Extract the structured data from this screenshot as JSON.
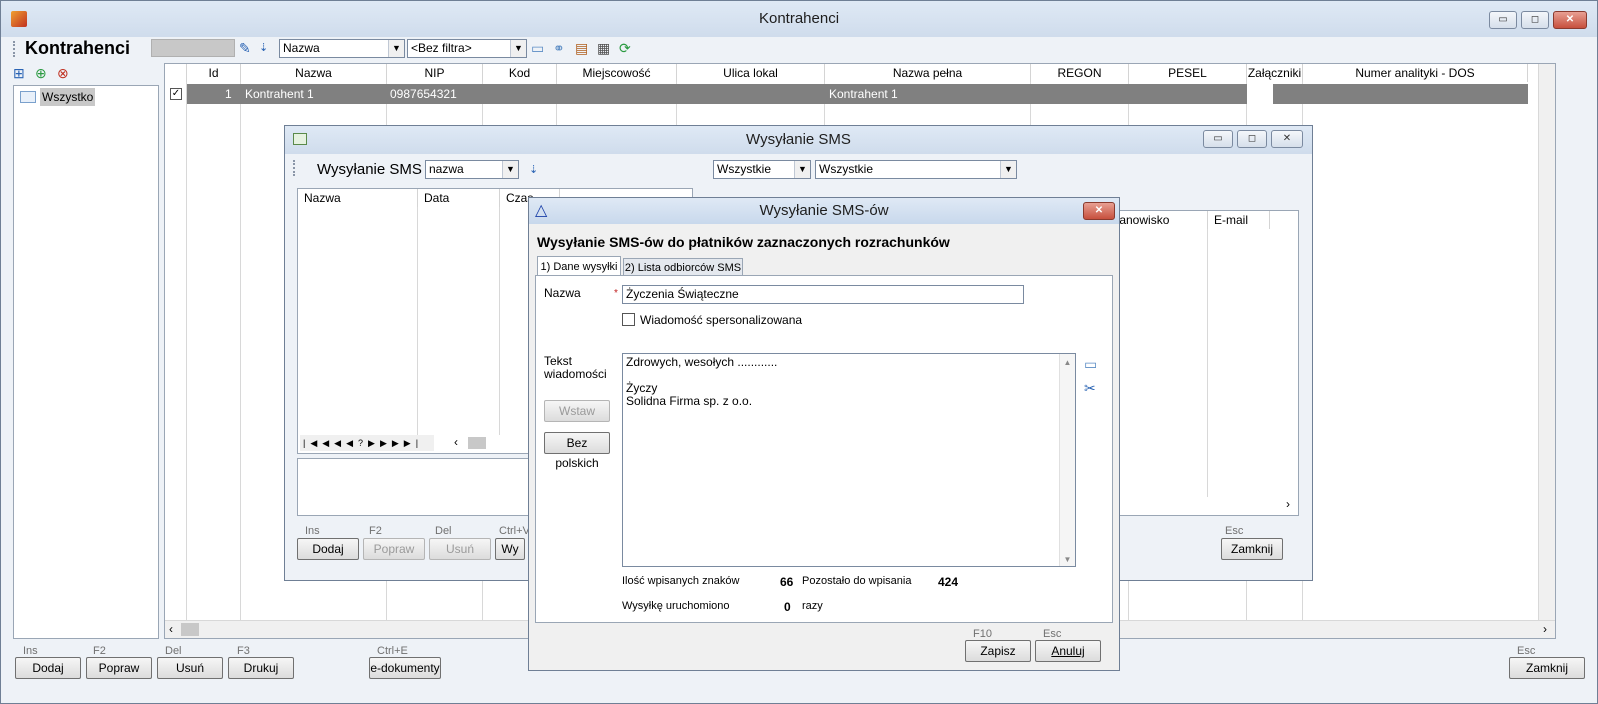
{
  "main": {
    "title": "Kontrahenci",
    "toolbar_title": "Kontrahenci",
    "sort_combo": "Nazwa",
    "filter_combo": "<Bez filtra>",
    "tree_item": "Wszystko",
    "columns": [
      "Id",
      "Nazwa",
      "NIP",
      "Kod pocztowy",
      "Miejscowość",
      "Ulica lokal",
      "Nazwa pełna",
      "REGON",
      "PESEL",
      "Załączniki",
      "Numer analityki - DOS"
    ],
    "row": {
      "id": "1",
      "nazwa": "Kontrahent 1",
      "nip": "0987654321",
      "nazwa_pelna": "Kontrahent 1"
    },
    "buttons": {
      "dodaj": {
        "key": "Ins",
        "label": "Dodaj"
      },
      "popraw": {
        "key": "F2",
        "label": "Popraw"
      },
      "usun": {
        "key": "Del",
        "label": "Usuń"
      },
      "drukuj": {
        "key": "F3",
        "label": "Drukuj"
      },
      "edok": {
        "key": "Ctrl+E",
        "label": "e-dokumenty"
      },
      "zamknij": {
        "key": "Esc",
        "label": "Zamknij"
      }
    }
  },
  "sms": {
    "title": "Wysyłanie SMS",
    "toolbar_title": "Wysyłanie SMS",
    "sort_combo": "nazwa",
    "combo1": "Wszystkie",
    "combo2": "Wszystkie",
    "columns_left": [
      "Nazwa",
      "Data",
      "Czas"
    ],
    "columns_right": [
      "Stanowisko",
      "E-mail"
    ],
    "buttons": {
      "dodaj": {
        "key": "Ins",
        "label": "Dodaj"
      },
      "popraw": {
        "key": "F2",
        "label": "Popraw"
      },
      "usun": {
        "key": "Del",
        "label": "Usuń"
      },
      "wy": {
        "key": "Ctrl+V",
        "label": "Wy"
      },
      "zamknij": {
        "key": "Esc",
        "label": "Zamknij"
      }
    }
  },
  "dialog": {
    "title": "Wysyłanie SMS-ów",
    "heading": "Wysyłanie SMS-ów do płatników zaznaczonych rozrachunków",
    "tabs": [
      "1) Dane wysyłki",
      "2) Lista odbiorców SMS"
    ],
    "nazwa_label": "Nazwa",
    "required_mark": "*",
    "nazwa_value": "Życzenia Świąteczne",
    "personalized_label": "Wiadomość spersonalizowana",
    "tekst_label_1": "Tekst",
    "tekst_label_2": "wiadomości",
    "wstaw": "Wstaw",
    "bez_polskich": "Bez polskich",
    "message_lines": [
      "Zdrowych, wesołych ............",
      "",
      "Życzy",
      "Solidna Firma sp. z o.o."
    ],
    "count_label": "Ilość wpisanych znaków",
    "count_value": "66",
    "remaining_label": "Pozostało do wpisania",
    "remaining_value": "424",
    "sent_label": "Wysyłkę uruchomiono",
    "sent_value": "0",
    "sent_suffix": "razy",
    "zapisz": {
      "key": "F10",
      "label": "Zapisz"
    },
    "anuluj": {
      "key": "Esc",
      "label": "Anuluj"
    }
  },
  "colors": {
    "selected_row": "#808080",
    "title_bg": "#d6e2f0",
    "accent": "#2a64b4"
  }
}
